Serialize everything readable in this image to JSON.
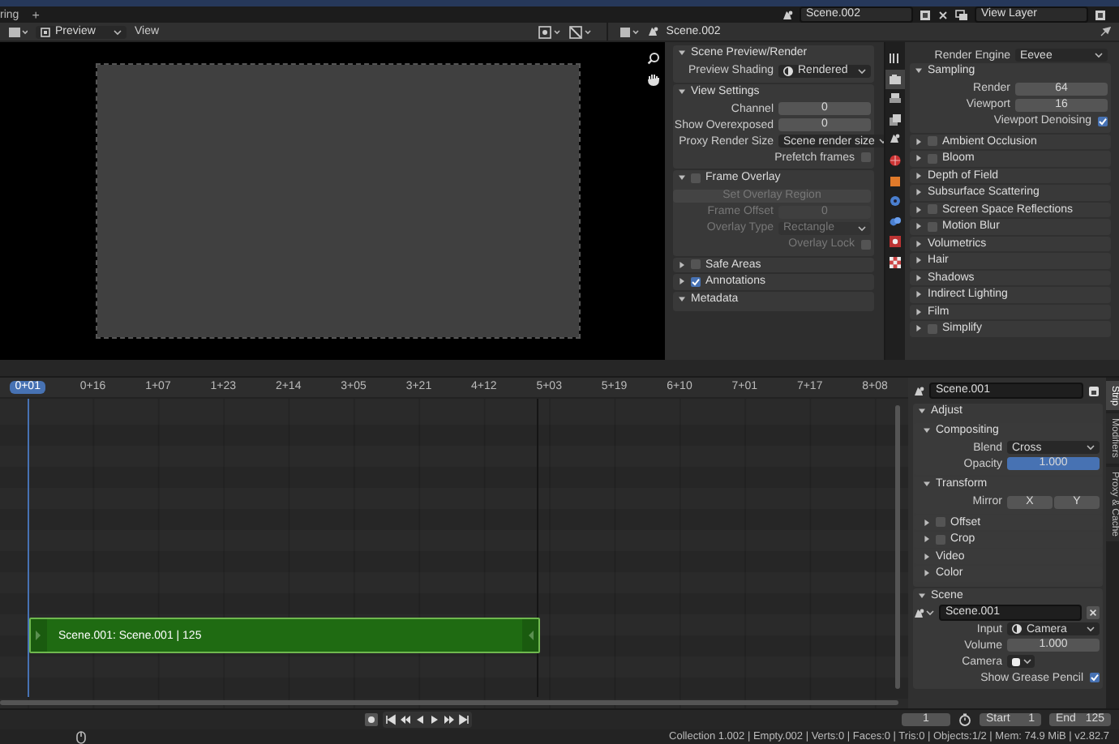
{
  "top_bar": {
    "workspace_tab": "ring",
    "add_tab": "+",
    "scene": "Scene.002",
    "view_layer": "View Layer"
  },
  "preview_header": {
    "mode": "Preview",
    "menu": "View"
  },
  "preview_sidebar": {
    "panels": [
      {
        "title": "Scene Preview/Render",
        "expanded": true,
        "rows": [
          {
            "kind": "dropdown_icon",
            "label": "Preview Shading",
            "value": "Rendered"
          }
        ]
      },
      {
        "title": "View Settings",
        "expanded": true,
        "rows": [
          {
            "kind": "number",
            "label": "Channel",
            "value": "0"
          },
          {
            "kind": "number",
            "label": "Show Overexposed",
            "value": "0"
          },
          {
            "kind": "dropdown",
            "label": "Proxy Render Size",
            "value": "Scene render size"
          },
          {
            "kind": "checkbox",
            "label": "Prefetch frames",
            "checked": false
          }
        ]
      },
      {
        "title": "Frame Overlay",
        "expanded": true,
        "checked": false,
        "rows": [
          {
            "kind": "button",
            "label": "Set Overlay Region",
            "disabled": true
          },
          {
            "kind": "number",
            "label": "Frame Offset",
            "value": "0",
            "disabled": true
          },
          {
            "kind": "dropdown",
            "label": "Overlay Type",
            "value": "Rectangle",
            "disabled": true
          },
          {
            "kind": "checkbox",
            "label": "Overlay Lock",
            "checked": false,
            "disabled": true
          }
        ]
      },
      {
        "title": "Safe Areas",
        "expanded": false,
        "checked": false
      },
      {
        "title": "Annotations",
        "expanded": false,
        "checked": true
      },
      {
        "title": "Metadata",
        "expanded": true
      }
    ]
  },
  "properties": {
    "header_scene": "Scene.002",
    "rows": [
      {
        "kind": "dropdown",
        "label": "Render Engine",
        "value": "Eevee"
      }
    ],
    "panels": [
      {
        "title": "Sampling",
        "expanded": true,
        "rows": [
          {
            "kind": "number",
            "label": "Render",
            "value": "64"
          },
          {
            "kind": "number",
            "label": "Viewport",
            "value": "16"
          },
          {
            "kind": "checkbox",
            "label": "Viewport Denoising",
            "checked": true
          }
        ]
      },
      {
        "title": "Ambient Occlusion",
        "expanded": false,
        "checked": false
      },
      {
        "title": "Bloom",
        "expanded": false,
        "checked": false
      },
      {
        "title": "Depth of Field",
        "expanded": false
      },
      {
        "title": "Subsurface Scattering",
        "expanded": false
      },
      {
        "title": "Screen Space Reflections",
        "expanded": false,
        "checked": false
      },
      {
        "title": "Motion Blur",
        "expanded": false,
        "checked": false
      },
      {
        "title": "Volumetrics",
        "expanded": false
      },
      {
        "title": "Hair",
        "expanded": false
      },
      {
        "title": "Shadows",
        "expanded": false
      },
      {
        "title": "Indirect Lighting",
        "expanded": false
      },
      {
        "title": "Film",
        "expanded": false
      },
      {
        "title": "Simplify",
        "expanded": false,
        "checked": false
      }
    ]
  },
  "sequencer": {
    "ruler": [
      {
        "label": "0+01",
        "selected": true
      },
      {
        "label": "0+16",
        "selected": false
      },
      {
        "label": "1+07",
        "selected": false
      },
      {
        "label": "1+23",
        "selected": false
      },
      {
        "label": "2+14",
        "selected": false
      },
      {
        "label": "3+05",
        "selected": false
      },
      {
        "label": "3+21",
        "selected": false
      },
      {
        "label": "4+12",
        "selected": false
      },
      {
        "label": "5+03",
        "selected": false
      },
      {
        "label": "5+19",
        "selected": false
      },
      {
        "label": "6+10",
        "selected": false
      },
      {
        "label": "7+01",
        "selected": false
      },
      {
        "label": "7+17",
        "selected": false
      },
      {
        "label": "8+08",
        "selected": false
      }
    ],
    "strips": [
      {
        "label": "Scene.001: Scene.001 | 125",
        "color": "#1f6b12"
      }
    ]
  },
  "sidebar": {
    "strip_name": "Scene.001",
    "tabs": [
      {
        "label": "Strip",
        "selected": true
      },
      {
        "label": "Modifiers",
        "selected": false
      },
      {
        "label": "Proxy & Cache",
        "selected": false
      }
    ],
    "panels": [
      {
        "title": "Adjust",
        "expanded": true,
        "children": [
          {
            "title": "Compositing",
            "expanded": true,
            "rows": [
              {
                "kind": "dropdown",
                "label": "Blend",
                "value": "Cross"
              },
              {
                "kind": "slider",
                "label": "Opacity",
                "value": "1.000",
                "level": 1
              }
            ]
          },
          {
            "title": "Transform",
            "expanded": true,
            "rows": [
              {
                "kind": "toggle_pair",
                "label": "Mirror",
                "options": [
                  "X",
                  "Y"
                ]
              }
            ]
          },
          {
            "title": "Offset",
            "expanded": false,
            "checked": false
          },
          {
            "title": "Crop",
            "expanded": false,
            "checked": false
          },
          {
            "title": "Video",
            "expanded": false
          },
          {
            "title": "Color",
            "expanded": false
          }
        ]
      },
      {
        "title": "Scene",
        "expanded": true,
        "rows": [
          {
            "kind": "scene_field",
            "value": "Scene.001"
          },
          {
            "kind": "dropdown_icon",
            "label": "Input",
            "value": "Camera"
          },
          {
            "kind": "number",
            "label": "Volume",
            "value": "1.000"
          },
          {
            "kind": "icon_dropdown",
            "label": "Camera"
          },
          {
            "kind": "checkbox",
            "label": "Show Grease Pencil",
            "checked": true
          }
        ]
      }
    ]
  },
  "playback": {
    "current_frame": "1",
    "start_label": "Start",
    "start": "1",
    "end_label": "End",
    "end": "125"
  },
  "status_bar": {
    "text": "Collection 1.002 | Empty.002 | Verts:0 | Faces:0 | Tris:0 | Objects:1/2 | Mem: 74.9 MiB | v2.82.7"
  }
}
